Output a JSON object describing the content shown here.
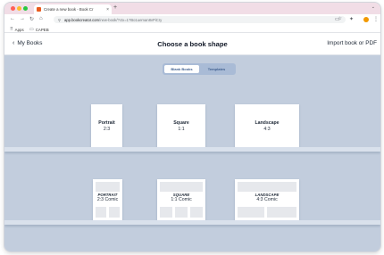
{
  "browser": {
    "tab_title": "Create a new book - Book Cr",
    "tab_close": "×",
    "new_tab": "+",
    "tab_menu": "⌄",
    "url_host": "app.bookcreator.com",
    "url_path": "/new-book/?ctx=1?Bo1ueman8vPiCry",
    "bookmarks": [
      {
        "label": "Apps",
        "icon": "apps-grid-icon"
      },
      {
        "label": "CAPEB",
        "icon": "folder-icon"
      }
    ]
  },
  "app": {
    "back_label": "My Books",
    "title": "Choose a book shape",
    "import_label": "Import book or PDF",
    "toggle": {
      "options": [
        "Blank Books",
        "Templates"
      ],
      "selected": "Blank Books"
    },
    "shelf1": [
      {
        "name": "Portrait",
        "ratio": "2:3"
      },
      {
        "name": "Square",
        "ratio": "1:1"
      },
      {
        "name": "Landscape",
        "ratio": "4:3"
      }
    ],
    "shelf2": [
      {
        "name": "PORTRAIT",
        "ratio": "2:3 Comic"
      },
      {
        "name": "SQUARE",
        "ratio": "1:1 Comic"
      },
      {
        "name": "LANDSCAPE",
        "ratio": "4:3 Comic"
      }
    ]
  },
  "colors": {
    "main_bg": "#c2cddd",
    "toggle_bg": "#a9bbd6",
    "shelf": "#d9e1ec",
    "tab_strip": "#f1dde6"
  }
}
